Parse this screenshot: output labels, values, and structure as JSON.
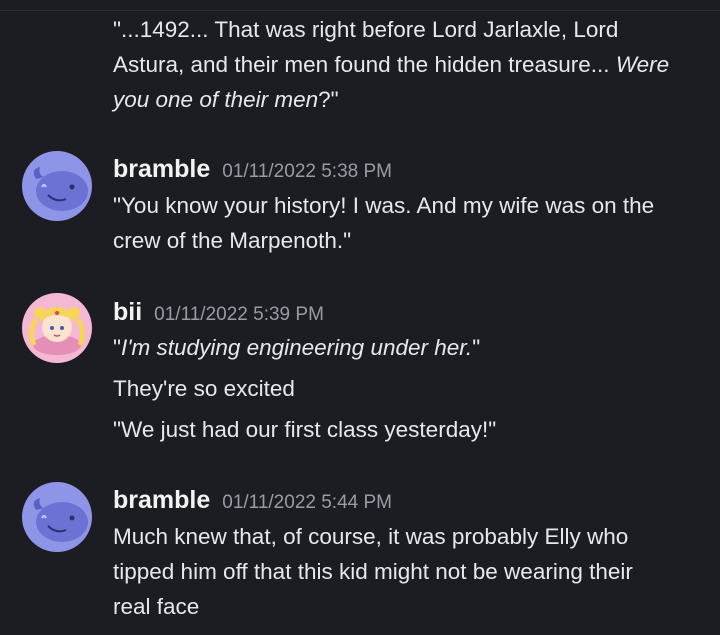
{
  "messages": [
    {
      "id": "m0",
      "continued": true,
      "lines": [
        {
          "parts": [
            {
              "text": "\"...1492... That was right before Lord Jarlaxle, Lord",
              "italic": false
            }
          ]
        },
        {
          "parts": [
            {
              "text": "Astura, and their men found the hidden treasure... ",
              "italic": false
            },
            {
              "text": "Were",
              "italic": true
            }
          ]
        },
        {
          "parts": [
            {
              "text": "you one of their men",
              "italic": true
            },
            {
              "text": "?\"",
              "italic": false
            }
          ]
        }
      ]
    },
    {
      "id": "m1",
      "author": "bramble",
      "timestamp": "01/11/2022 5:38 PM",
      "avatar": "whale-avatar",
      "lines": [
        {
          "parts": [
            {
              "text": "\"You know your history! I was. And my wife was on the",
              "italic": false
            }
          ]
        },
        {
          "parts": [
            {
              "text": "crew of the Marpenoth.\"",
              "italic": false
            }
          ]
        }
      ]
    },
    {
      "id": "m2",
      "author": "bii",
      "timestamp": "01/11/2022 5:39 PM",
      "avatar": "sailor-moon-avatar",
      "lines": [
        {
          "parts": [
            {
              "text": "\"",
              "italic": false
            },
            {
              "text": "I'm studying engineering under her.",
              "italic": true
            },
            {
              "text": "\"",
              "italic": false
            }
          ]
        },
        {
          "parts": [
            {
              "text": "They're so excited",
              "italic": false
            }
          ]
        },
        {
          "parts": [
            {
              "text": "\"We just had our first class yesterday!\"",
              "italic": false
            }
          ]
        }
      ]
    },
    {
      "id": "m3",
      "author": "bramble",
      "timestamp": "01/11/2022 5:44 PM",
      "avatar": "whale-avatar",
      "lines": [
        {
          "parts": [
            {
              "text": "Much knew that, of course, it was probably Elly who",
              "italic": false
            }
          ]
        },
        {
          "parts": [
            {
              "text": "tipped him off that this kid might not be wearing their",
              "italic": false
            }
          ]
        },
        {
          "parts": [
            {
              "text": "real face",
              "italic": false
            }
          ]
        }
      ]
    }
  ],
  "colors": {
    "background": "#1c1d22",
    "text": "#e7e8ec",
    "username": "#f2f3f5",
    "timestamp": "#9a9ca5",
    "whale_bg": "#8e95e6",
    "bii_bg": "#f4b8d4"
  }
}
